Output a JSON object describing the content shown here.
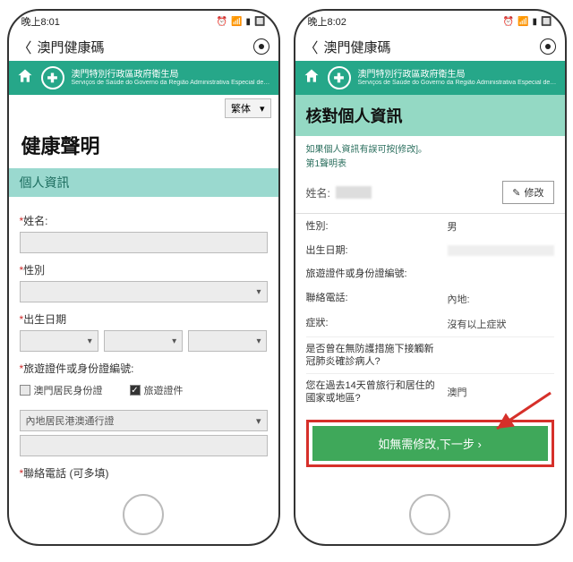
{
  "left": {
    "status_time": "晚上8:01",
    "nav_title": "澳門健康碼",
    "agency_title": "澳門特別行政區政府衛生局",
    "agency_sub": "Serviços de Saúde do Governo da Região Administrativa Especial de…",
    "lang_value": "繁体",
    "heading": "健康聲明",
    "section": "個人資訊",
    "labels": {
      "name": "姓名:",
      "gender": "性別",
      "dob": "出生日期",
      "doc": "旅遊證件或身份證編號:",
      "phone": "聯絡電話 (可多填)"
    },
    "checks": {
      "resident": "澳門居民身份證",
      "travel": "旅遊證件"
    },
    "doc_type_placeholder": "內地居民港澳通行證"
  },
  "right": {
    "status_time": "晚上8:02",
    "nav_title": "澳門健康碼",
    "agency_title": "澳門特別行政區政府衛生局",
    "agency_sub": "Serviços de Saúde do Governo da Região Administrativa Especial de…",
    "verify_heading": "核對個人資訊",
    "hint_line1": "如果個人資訊有誤可按[修改]。",
    "hint_line2": "第1聲明表",
    "name_label": "姓名:",
    "edit_label": "修改",
    "rows": [
      {
        "k": "性別:",
        "v": "男"
      },
      {
        "k": "出生日期:",
        "v": ""
      },
      {
        "k": "旅遊證件或身份證編號:",
        "v": ""
      },
      {
        "k": "聯絡電話:",
        "v": "內地:"
      },
      {
        "k": "症狀:",
        "v": "沒有以上症狀"
      },
      {
        "k": "是否曾在無防護措施下接觸新冠肺炎確診病人?",
        "v": ""
      },
      {
        "k": "您在過去14天曾旅行和居住的國家或地區?",
        "v": "澳門"
      }
    ],
    "next_label": "如無需修改,下一步 ›"
  }
}
